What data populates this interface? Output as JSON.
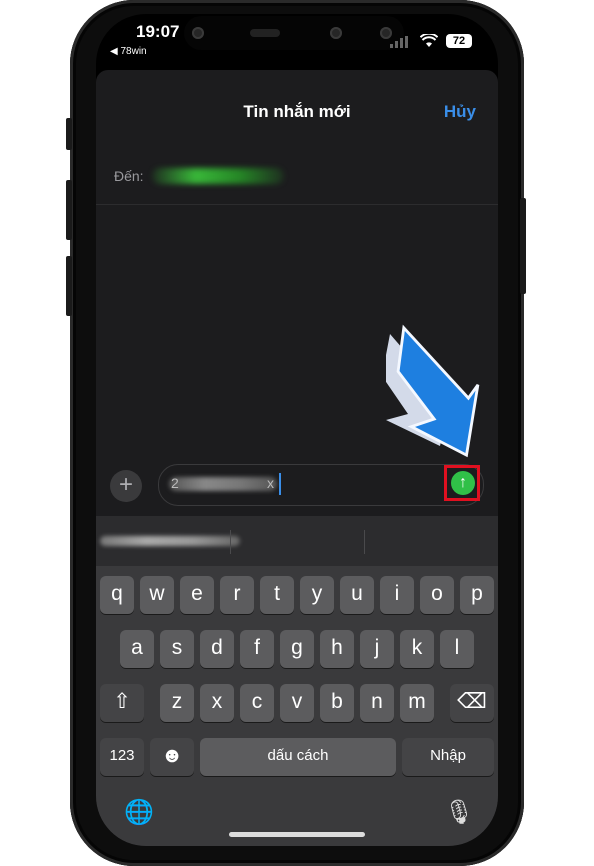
{
  "status": {
    "time": "19:07",
    "back_app": "◀ 78win",
    "battery": "72",
    "wifi_icon": "wifi-icon"
  },
  "header": {
    "title": "Tin nhắn mới",
    "cancel": "Hủy"
  },
  "to": {
    "label": "Đến:"
  },
  "input": {
    "visible_start": "2",
    "visible_end": "x"
  },
  "send_icon": "↑",
  "plus_icon": "+",
  "keyboard": {
    "row1": [
      "q",
      "w",
      "e",
      "r",
      "t",
      "y",
      "u",
      "i",
      "o",
      "p"
    ],
    "row2": [
      "a",
      "s",
      "d",
      "f",
      "g",
      "h",
      "j",
      "k",
      "l"
    ],
    "row3": [
      "z",
      "x",
      "c",
      "v",
      "b",
      "n",
      "m"
    ],
    "shift_icon": "⇧",
    "delete_icon": "⌫",
    "numbers": "123",
    "emoji_icon": "☻",
    "space": "dấu cách",
    "return": "Nhập",
    "globe_icon": "🌐",
    "mic_icon": "🎙"
  },
  "colors": {
    "accent": "#3a8ee8",
    "send": "#30c048",
    "highlight": "#e01020",
    "arrow": "#1e7fe0"
  }
}
